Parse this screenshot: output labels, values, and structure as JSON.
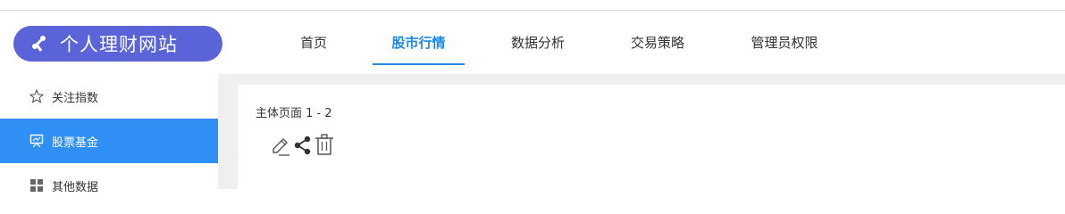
{
  "app": {
    "title": "个人理财网站"
  },
  "nav": {
    "items": [
      {
        "label": "首页",
        "active": false
      },
      {
        "label": "股市行情",
        "active": true
      },
      {
        "label": "数据分析",
        "active": false
      },
      {
        "label": "交易策略",
        "active": false
      },
      {
        "label": "管理员权限",
        "active": false
      }
    ]
  },
  "sidebar": {
    "items": [
      {
        "label": "关注指数",
        "icon": "star-icon",
        "active": false
      },
      {
        "label": "股票基金",
        "icon": "presentation-icon",
        "active": true
      },
      {
        "label": "其他数据",
        "icon": "grid-icon",
        "active": false
      }
    ]
  },
  "content": {
    "page_label": "主体页面 1 - 2",
    "tools": [
      "edit-icon",
      "share-icon",
      "trash-icon"
    ]
  },
  "colors": {
    "brand": "#5a63d8",
    "accent": "#1e88e5",
    "active_sidebar": "#2f8ff5"
  }
}
